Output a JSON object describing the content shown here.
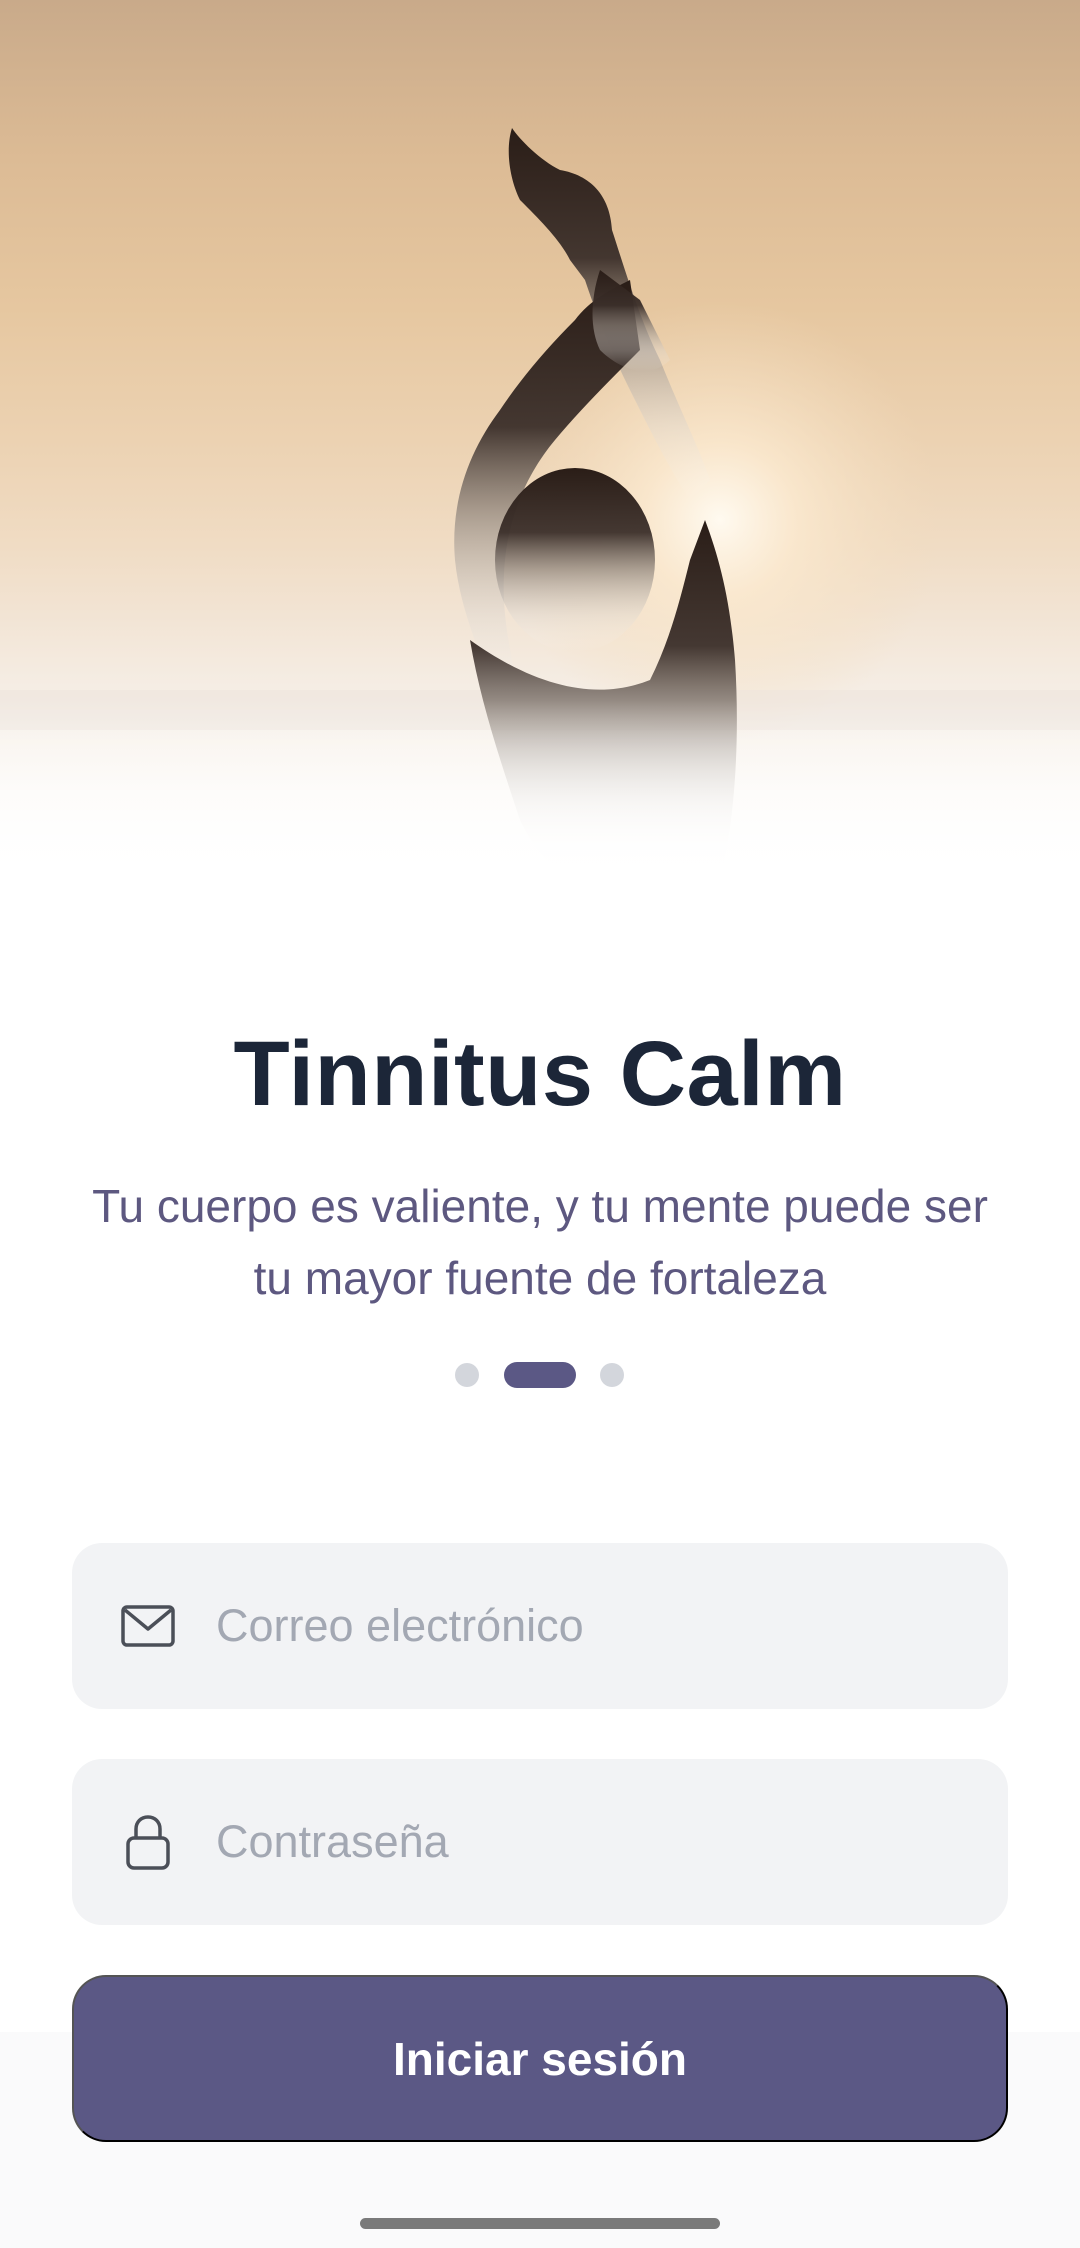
{
  "app": {
    "title": "Tinnitus Calm",
    "tagline": "Tu cuerpo es valiente, y tu mente puede ser tu mayor fuente de fortaleza"
  },
  "carousel": {
    "total_pages": 3,
    "active_index": 1
  },
  "form": {
    "email": {
      "placeholder": "Correo electrónico",
      "value": "",
      "icon": "mail-icon"
    },
    "password": {
      "placeholder": "Contraseña",
      "value": "",
      "icon": "lock-icon"
    },
    "submit_label": "Iniciar sesión"
  },
  "colors": {
    "primary": "#5b5885",
    "title": "#1c2638",
    "subtitle": "#5d5880",
    "field_bg": "#f2f3f5",
    "dot_inactive": "#d3d6dc"
  }
}
